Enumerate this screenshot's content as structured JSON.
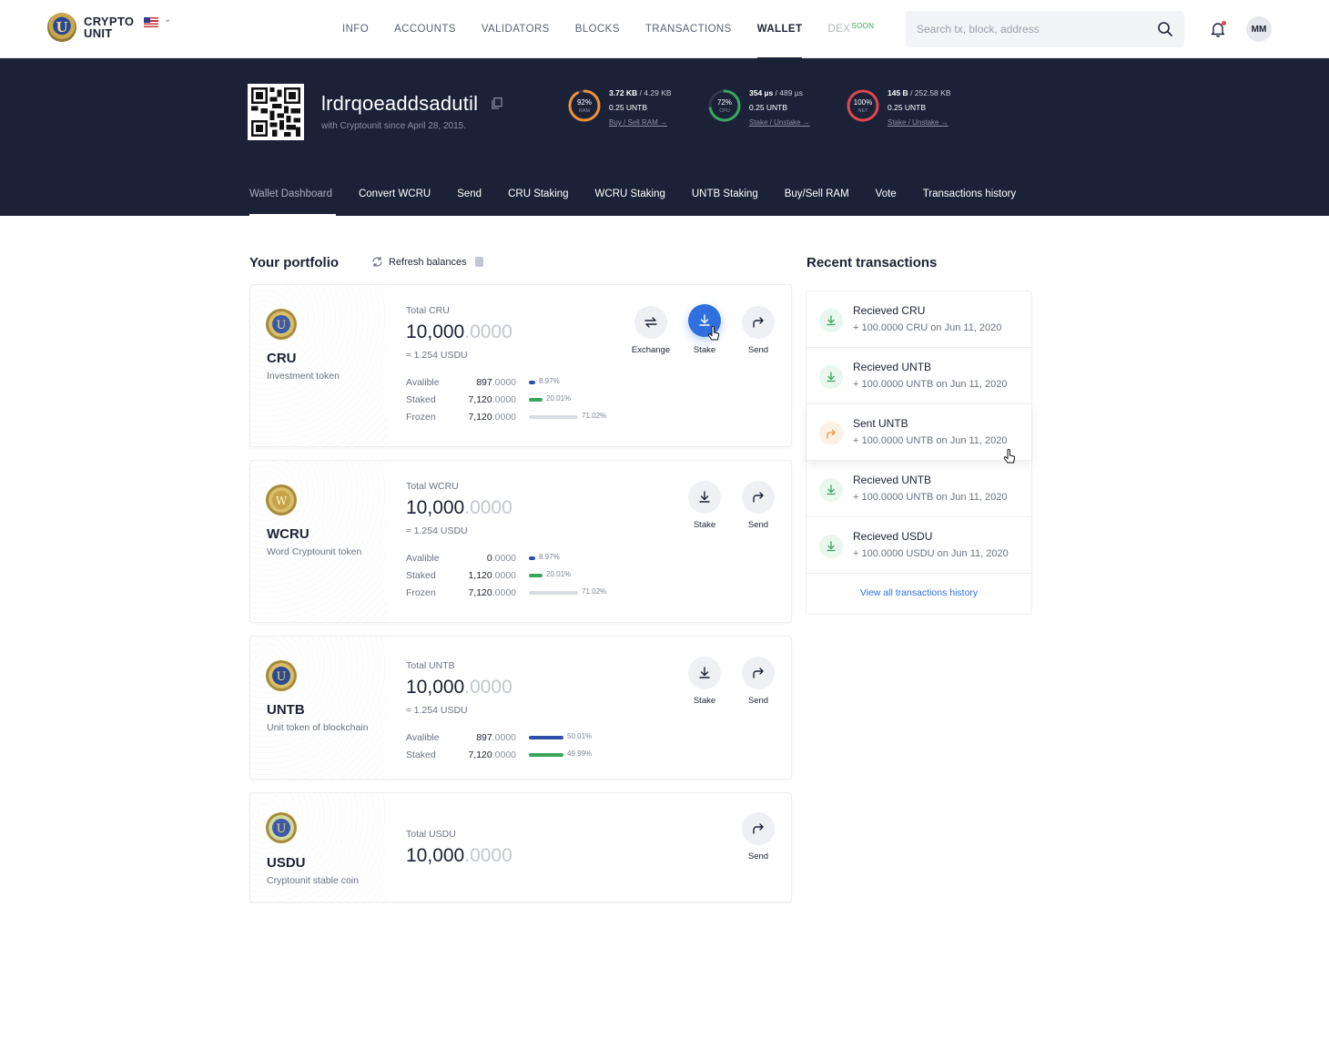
{
  "brand": {
    "name_line1": "CRYPTO",
    "name_line2": "UNIT"
  },
  "nav": {
    "items": [
      "INFO",
      "ACCOUNTS",
      "VALIDATORS",
      "BLOCKS",
      "TRANSACTIONS",
      "WALLET",
      "DEX"
    ],
    "active": "WALLET",
    "soon_badge": "SOON"
  },
  "search": {
    "placeholder": "Search tx, block, address"
  },
  "user": {
    "initials": "MM"
  },
  "account": {
    "name": "lrdrqoeaddsadutil",
    "since": "with Cryptounit since April 28, 2015."
  },
  "resources": [
    {
      "pct": "92%",
      "label": "RAM",
      "used": "3.72 KB",
      "total": "/ 4.29 KB",
      "stake": "0.25 UNTB",
      "link": "Buy / Sell RAM →",
      "fraction": 0.92,
      "color": "#f0913a"
    },
    {
      "pct": "72%",
      "label": "CPU",
      "used": "354 µs",
      "total": "/ 489 µs",
      "stake": "0.25 UNTB",
      "link": "Stake / Unstake →",
      "fraction": 0.72,
      "color": "#3aa55d"
    },
    {
      "pct": "100%",
      "label": "NET",
      "used": "145 B",
      "total": "/ 252.58 KB",
      "stake": "0.25 UNTB",
      "link": "Stake / Unstake →",
      "fraction": 1.0,
      "color": "#e0464e"
    }
  ],
  "tabs": [
    "Wallet Dashboard",
    "Convert WCRU",
    "Send",
    "CRU Staking",
    "WCRU Staking",
    "UNTB Staking",
    "Buy/Sell RAM",
    "Vote",
    "Transactions history"
  ],
  "portfolio": {
    "title": "Your portfolio",
    "refresh": "Refresh balances",
    "tokens": [
      {
        "symbol": "CRU",
        "desc": "Investment token",
        "total_label": "Total CRU",
        "total_int": "10,000",
        "total_dec": ".0000",
        "approx": "≈ 1.254 USDU",
        "rows": [
          {
            "label": "Avalible",
            "int": "897",
            "dec": ".0000",
            "pct": "8.97%",
            "fraction": 0.0897,
            "color": "#2d4fa8"
          },
          {
            "label": "Staked",
            "int": "7,120",
            "dec": ".0000",
            "pct": "20.01%",
            "fraction": 0.2001,
            "color": "#3aa55d"
          },
          {
            "label": "Frozen",
            "int": "7,120",
            "dec": ".0000",
            "pct": "71.02%",
            "fraction": 0.7102,
            "color": "#d9dce2"
          }
        ],
        "actions": [
          "Exchange",
          "Stake",
          "Send"
        ]
      },
      {
        "symbol": "WCRU",
        "desc": "Word Cryptounit token",
        "total_label": "Total WCRU",
        "total_int": "10,000",
        "total_dec": ".0000",
        "approx": "≈ 1.254 USDU",
        "rows": [
          {
            "label": "Avalible",
            "int": "0",
            "dec": ".0000",
            "pct": "8.97%",
            "fraction": 0.0897,
            "color": "#2d4fa8"
          },
          {
            "label": "Staked",
            "int": "1,120",
            "dec": ".0000",
            "pct": "20.01%",
            "fraction": 0.2001,
            "color": "#3aa55d"
          },
          {
            "label": "Frozen",
            "int": "7,120",
            "dec": ".0000",
            "pct": "71.02%",
            "fraction": 0.7102,
            "color": "#d9dce2"
          }
        ],
        "actions": [
          "Stake",
          "Send"
        ]
      },
      {
        "symbol": "UNTB",
        "desc": "Unit token of blockchain",
        "total_label": "Total UNTB",
        "total_int": "10,000",
        "total_dec": ".0000",
        "approx": "≈ 1.254 USDU",
        "rows": [
          {
            "label": "Avalible",
            "int": "897",
            "dec": ".0000",
            "pct": "50.01%",
            "fraction": 0.5001,
            "color": "#2d4fa8"
          },
          {
            "label": "Staked",
            "int": "7,120",
            "dec": ".0000",
            "pct": "49.99%",
            "fraction": 0.4999,
            "color": "#3aa55d"
          }
        ],
        "actions": [
          "Stake",
          "Send"
        ]
      },
      {
        "symbol": "USDU",
        "desc": "Cryptounit stable coin",
        "total_label": "Total USDU",
        "total_int": "10,000",
        "total_dec": ".0000",
        "actions": [
          "Send"
        ]
      }
    ]
  },
  "recent": {
    "title": "Recent transactions",
    "items": [
      {
        "title": "Recieved CRU",
        "sub": "+ 100.0000 CRU on Jun 11, 2020",
        "dir": "in"
      },
      {
        "title": "Recieved UNTB",
        "sub": "+ 100.0000 UNTB on Jun 11, 2020",
        "dir": "in"
      },
      {
        "title": "Sent UNTB",
        "sub": "+ 100.0000 UNTB on Jun 11, 2020",
        "dir": "out"
      },
      {
        "title": "Recieved UNTB",
        "sub": "+ 100.0000 UNTB on Jun 11, 2020",
        "dir": "in"
      },
      {
        "title": "Recieved USDU",
        "sub": "+ 100.0000 USDU on Jun 11, 2020",
        "dir": "in"
      }
    ],
    "view_all": "View all transactions history"
  },
  "colors": {
    "primary": "#2f6fde",
    "header_bg": "#1b2238",
    "positive": "#3aa55d",
    "negative": "#e0464e"
  }
}
